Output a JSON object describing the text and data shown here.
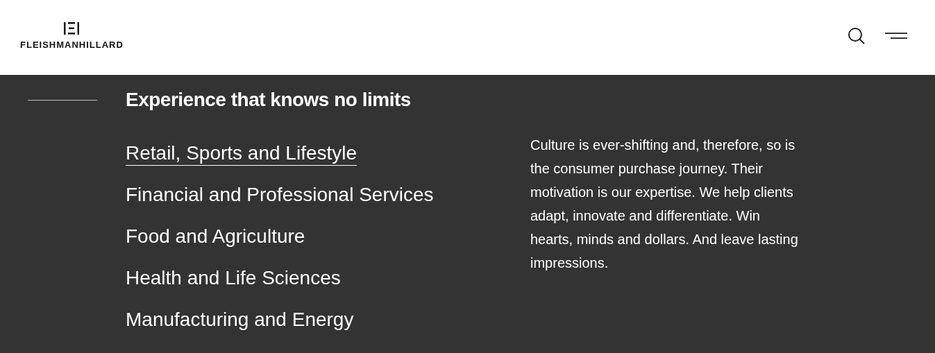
{
  "header": {
    "logo_text": "FLEISHMANHILLARD"
  },
  "section": {
    "heading": "Experience that knows no limits",
    "industries": [
      {
        "label": "Retail, Sports and Lifestyle",
        "selected": true
      },
      {
        "label": "Financial and Professional Services",
        "selected": false
      },
      {
        "label": "Food and Agriculture",
        "selected": false
      },
      {
        "label": "Health and Life Sciences",
        "selected": false
      },
      {
        "label": "Manufacturing and Energy",
        "selected": false
      }
    ],
    "description": "Culture is ever-shifting and, therefore, so is the consumer purchase journey. Their motivation is our expertise. We help clients adapt, innovate and differentiate. Win hearts, minds and dollars. And leave lasting impressions."
  }
}
